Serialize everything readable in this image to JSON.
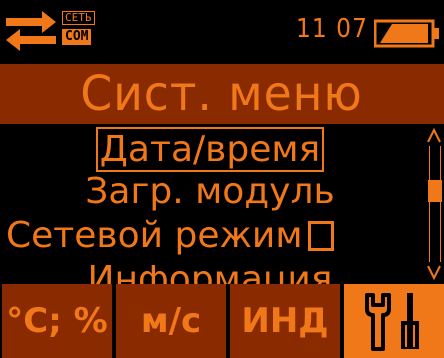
{
  "status": {
    "network_label": "СЕТЬ",
    "com_label": "COM",
    "time": "11 07",
    "icons": [
      "transfer-arrows-icon",
      "battery-icon"
    ]
  },
  "title": "Сист. меню",
  "menu": {
    "items": [
      {
        "label": "Дата/время",
        "selected": true
      },
      {
        "label": "Загр. модуль",
        "selected": false
      },
      {
        "label": "Сетевой режим",
        "checkbox": false
      },
      {
        "label": "Информация",
        "selected": false
      }
    ]
  },
  "softkeys": [
    {
      "label": "°C; %"
    },
    {
      "label": "м/с"
    },
    {
      "label": "ИНД"
    },
    {
      "label": "",
      "icon": "tools-icon"
    }
  ],
  "colors": {
    "accent": "#f07818",
    "panel": "#8a2a00",
    "background": "#000000"
  }
}
